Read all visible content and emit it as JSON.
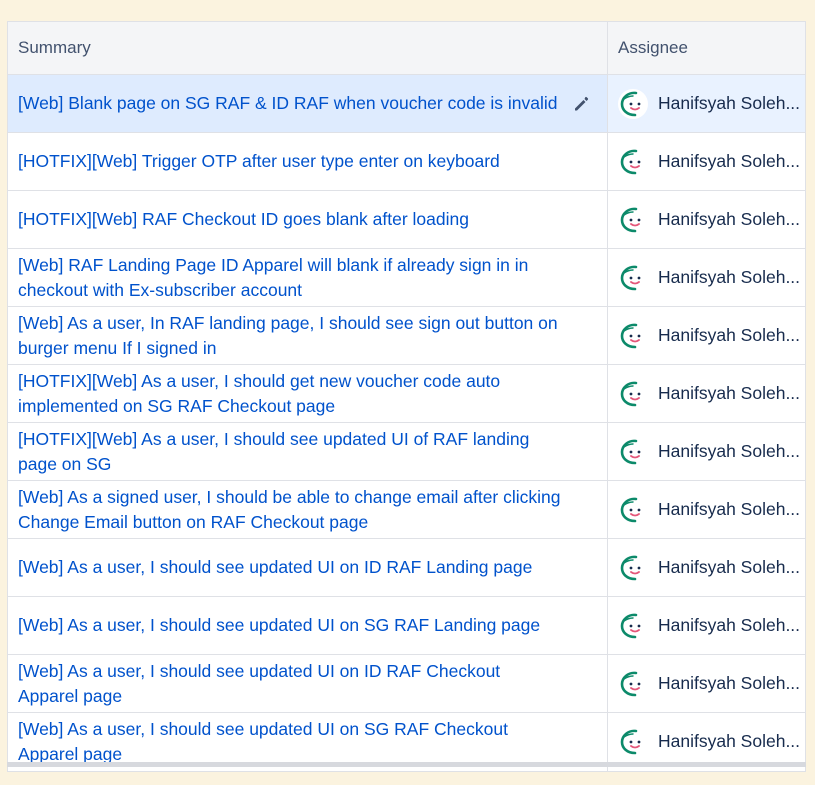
{
  "table": {
    "headers": {
      "summary": "Summary",
      "assignee": "Assignee"
    },
    "rows": [
      {
        "summary": "[Web] Blank page on SG RAF & ID RAF when voucher code is invalid",
        "assignee": "Hanifsyah Soleh..."
      },
      {
        "summary": "[HOTFIX][Web] Trigger OTP after user type enter on keyboard",
        "assignee": "Hanifsyah Soleh..."
      },
      {
        "summary": "[HOTFIX][Web] RAF Checkout ID goes blank after loading",
        "assignee": "Hanifsyah Soleh..."
      },
      {
        "summary": "[Web] RAF Landing Page ID Apparel will blank if already sign in in checkout with Ex-subscriber account",
        "assignee": "Hanifsyah Soleh..."
      },
      {
        "summary": "[Web] As a user, In RAF landing page, I should see sign out button on burger menu If I signed in",
        "assignee": "Hanifsyah Soleh..."
      },
      {
        "summary": "[HOTFIX][Web] As a user, I should get new voucher code auto implemented on SG RAF Checkout page",
        "assignee": "Hanifsyah Soleh..."
      },
      {
        "summary": "[HOTFIX][Web] As a user, I should see updated UI of RAF landing page on SG",
        "assignee": "Hanifsyah Soleh..."
      },
      {
        "summary": "[Web] As a signed user, I should be able to change email after clicking Change Email button on RAF Checkout page",
        "assignee": "Hanifsyah Soleh..."
      },
      {
        "summary": "[Web] As a user, I should see updated UI on ID RAF Landing page",
        "assignee": "Hanifsyah Soleh..."
      },
      {
        "summary": "[Web] As a user, I should see updated UI on SG RAF Landing page",
        "assignee": "Hanifsyah Soleh..."
      },
      {
        "summary": "[Web] As a user, I should see updated UI on ID RAF Checkout Apparel page",
        "assignee": "Hanifsyah Soleh..."
      },
      {
        "summary": "[Web] As a user, I should see updated UI on SG RAF Checkout Apparel page",
        "assignee": "Hanifsyah Soleh..."
      }
    ]
  }
}
